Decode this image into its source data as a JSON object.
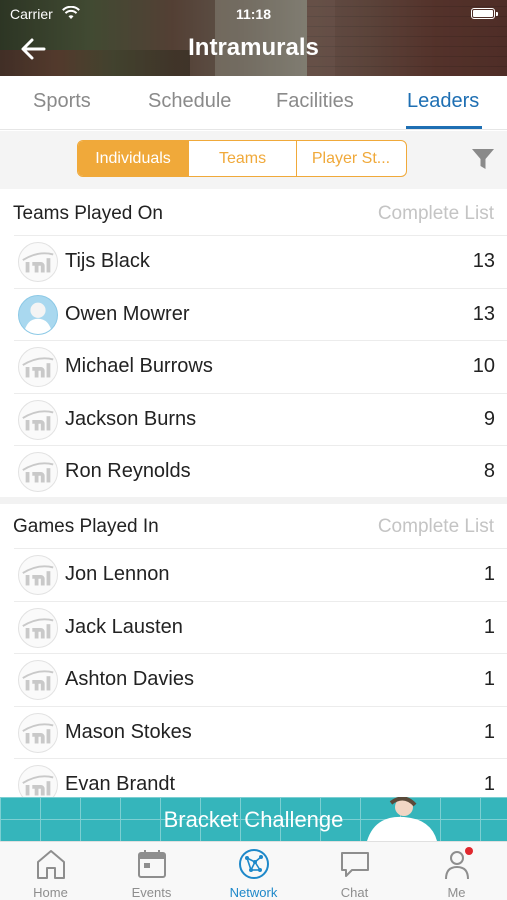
{
  "status": {
    "carrier": "Carrier",
    "time": "11:18"
  },
  "header": {
    "title": "Intramurals"
  },
  "tabs": [
    {
      "label": "Sports"
    },
    {
      "label": "Schedule"
    },
    {
      "label": "Facilities"
    },
    {
      "label": "Leaders"
    }
  ],
  "segments": [
    {
      "label": "Individuals"
    },
    {
      "label": "Teams"
    },
    {
      "label": "Player St..."
    }
  ],
  "sections": [
    {
      "title": "Teams Played On",
      "link": "Complete List",
      "rows": [
        {
          "name": "Tijs Black",
          "value": "13",
          "avatar": "logo"
        },
        {
          "name": "Owen Mowrer",
          "value": "13",
          "avatar": "photo"
        },
        {
          "name": "Michael Burrows",
          "value": "10",
          "avatar": "logo"
        },
        {
          "name": "Jackson Burns",
          "value": "9",
          "avatar": "logo"
        },
        {
          "name": "Ron Reynolds",
          "value": "8",
          "avatar": "logo"
        }
      ]
    },
    {
      "title": "Games Played In",
      "link": "Complete List",
      "rows": [
        {
          "name": "Jon Lennon",
          "value": "1",
          "avatar": "logo"
        },
        {
          "name": "Jack Lausten",
          "value": "1",
          "avatar": "logo"
        },
        {
          "name": "Ashton Davies",
          "value": "1",
          "avatar": "logo"
        },
        {
          "name": "Mason Stokes",
          "value": "1",
          "avatar": "logo"
        },
        {
          "name": "Evan Brandt",
          "value": "1",
          "avatar": "logo"
        }
      ]
    }
  ],
  "banner": {
    "text": "Bracket Challenge"
  },
  "nav": [
    {
      "label": "Home",
      "icon": "home-icon"
    },
    {
      "label": "Events",
      "icon": "calendar-icon"
    },
    {
      "label": "Network",
      "icon": "network-icon"
    },
    {
      "label": "Chat",
      "icon": "chat-icon"
    },
    {
      "label": "Me",
      "icon": "person-icon"
    }
  ],
  "colors": {
    "accent": "#f0a93a",
    "tab_active": "#1e6fb3",
    "banner": "#35b5bb",
    "nav_active": "#1e88c9",
    "badge": "#e0282e"
  }
}
